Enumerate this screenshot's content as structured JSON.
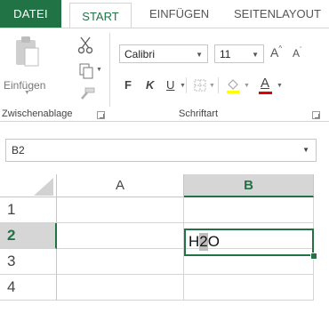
{
  "ribbon_tabs": {
    "file": "DATEI",
    "start": "START",
    "insert": "EINFÜGEN",
    "page_layout": "SEITENLAYOUT"
  },
  "clipboard": {
    "paste_label": "Einfügen",
    "group_label": "Zwischenablage"
  },
  "font": {
    "name": "Calibri",
    "size": "11",
    "grow_label": "A",
    "shrink_label": "A",
    "bold_label": "F",
    "italic_label": "K",
    "underline_label": "U",
    "font_color_label": "A",
    "group_label": "Schriftart",
    "font_color": "#e00000",
    "highlight_color": "#ffff00"
  },
  "name_box": {
    "value": "B2"
  },
  "grid": {
    "columns": [
      "A",
      "B"
    ],
    "rows": [
      "1",
      "2",
      "3",
      "4"
    ],
    "selected_column": "B",
    "selected_row": "2",
    "active_cell_text": {
      "before": "H",
      "highlighted": "2",
      "after": "O"
    }
  },
  "colors": {
    "accent": "#217346",
    "header_selected_bg": "#d6d6d6"
  }
}
